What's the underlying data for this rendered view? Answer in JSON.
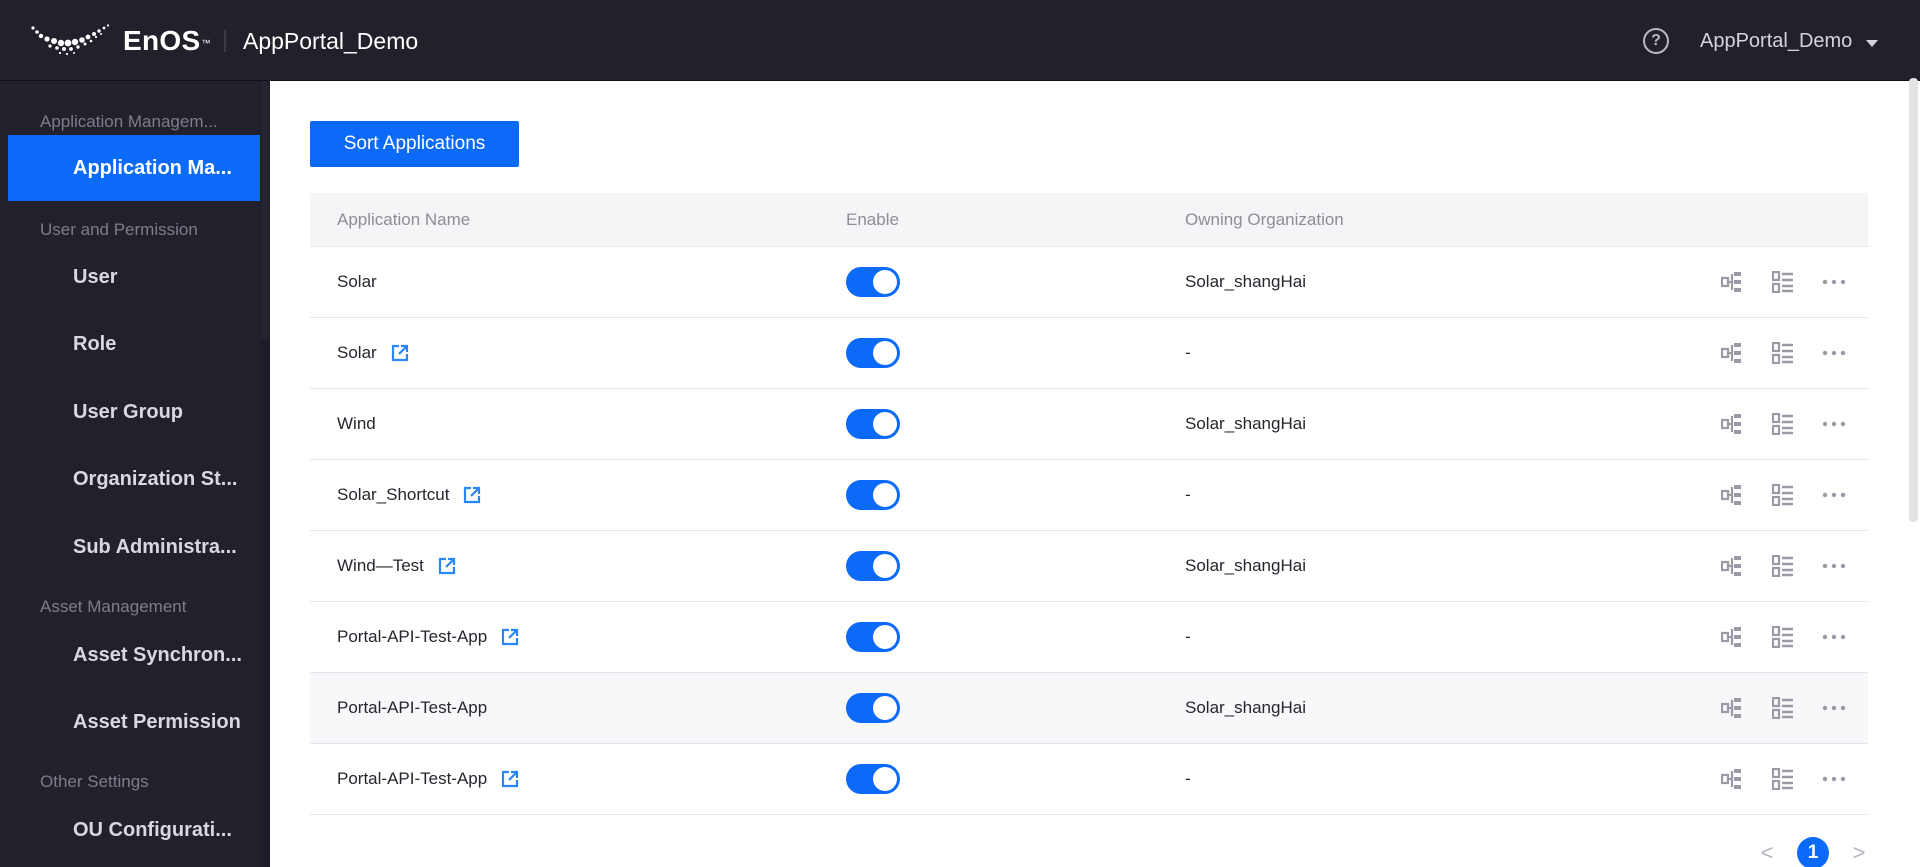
{
  "header": {
    "brand_name": "EnOS",
    "brand_mark": "™",
    "app_title": "AppPortal_Demo",
    "help_icon": "question-circle-icon",
    "user_name": "AppPortal_Demo",
    "user_menu_icon": "caret-down-icon"
  },
  "sidebar": {
    "groups": [
      {
        "label": "Application Managem...",
        "items": [
          {
            "label": "Application Ma...",
            "active": true
          }
        ]
      },
      {
        "label": "User and Permission",
        "items": [
          {
            "label": "User"
          },
          {
            "label": "Role"
          },
          {
            "label": "User Group"
          },
          {
            "label": "Organization St..."
          },
          {
            "label": "Sub Administra..."
          }
        ]
      },
      {
        "label": "Asset Management",
        "items": [
          {
            "label": "Asset Synchron..."
          },
          {
            "label": "Asset Permission"
          }
        ]
      },
      {
        "label": "Other Settings",
        "items": [
          {
            "label": "OU Configurati..."
          }
        ]
      }
    ]
  },
  "toolbar": {
    "sort_label": "Sort Applications"
  },
  "table": {
    "columns": [
      "Application Name",
      "Enable",
      "Owning Organization"
    ],
    "rows": [
      {
        "name": "Solar",
        "external_link": false,
        "enabled": true,
        "org": "Solar_shangHai"
      },
      {
        "name": "Solar",
        "external_link": true,
        "enabled": true,
        "org": "-"
      },
      {
        "name": "Wind",
        "external_link": false,
        "enabled": true,
        "org": "Solar_shangHai"
      },
      {
        "name": "Solar_Shortcut",
        "external_link": true,
        "enabled": true,
        "org": "-"
      },
      {
        "name": "Wind—Test",
        "external_link": true,
        "enabled": true,
        "org": "Solar_shangHai"
      },
      {
        "name": "Portal-API-Test-App",
        "external_link": true,
        "enabled": true,
        "org": "-"
      },
      {
        "name": "Portal-API-Test-App",
        "external_link": false,
        "enabled": true,
        "org": "Solar_shangHai",
        "hovered": true
      },
      {
        "name": "Portal-API-Test-App",
        "external_link": true,
        "enabled": true,
        "org": "-"
      }
    ],
    "row_actions": [
      "hierarchy-icon",
      "list-icon",
      "more-icon"
    ]
  },
  "pagination": {
    "prev": "<",
    "current_page": "1",
    "next": ">"
  },
  "colors": {
    "accent": "#0b6bf8",
    "header_bg": "#21212b",
    "sidebar_bg": "#22212b",
    "table_header_bg": "#f5f5f8",
    "icon_gray": "#9a9aa6"
  }
}
